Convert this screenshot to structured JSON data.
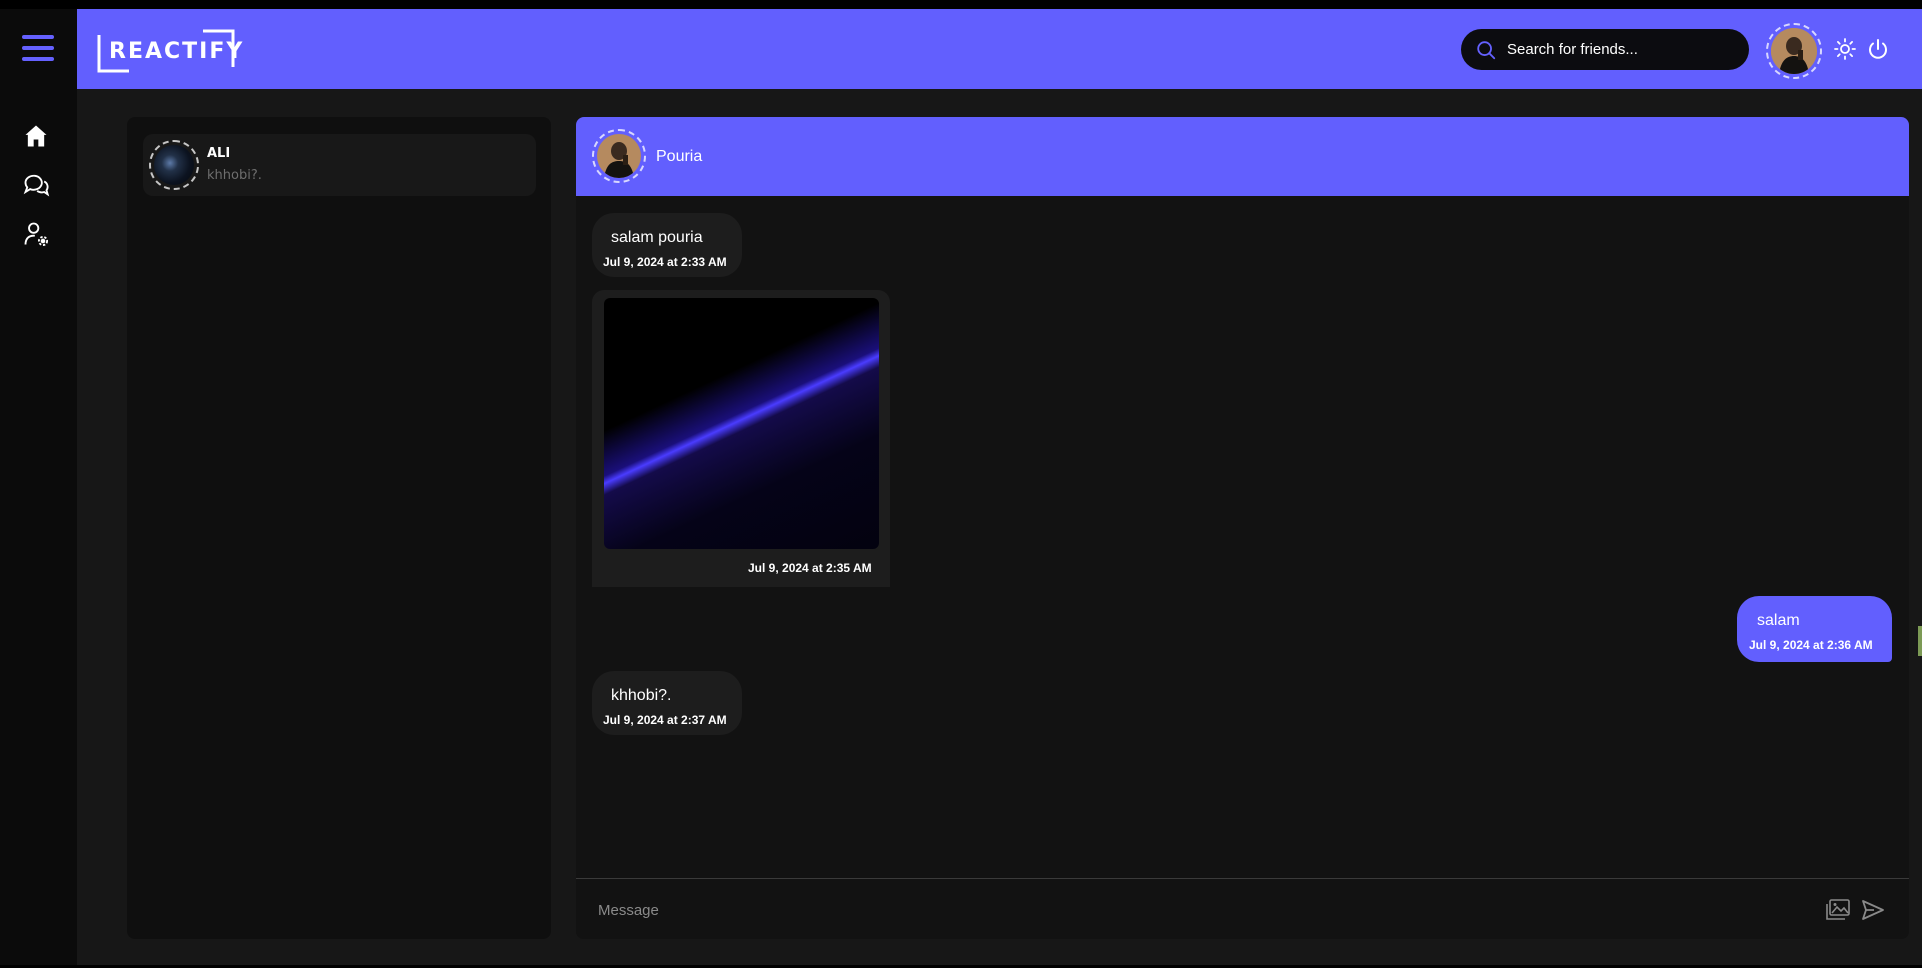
{
  "app": {
    "logo_text": "REACTIFY",
    "accent": "#625ffe"
  },
  "sidebar": {
    "items": [
      {
        "name": "home",
        "icon": "home-icon"
      },
      {
        "name": "chats",
        "icon": "chat-bubbles-icon"
      },
      {
        "name": "profile-settings",
        "icon": "user-gear-icon"
      }
    ]
  },
  "header": {
    "search": {
      "placeholder": "Search for friends..."
    },
    "theme_icon": "sun-icon",
    "logout_icon": "power-icon"
  },
  "chat_list": {
    "items": [
      {
        "name": "ALI",
        "last_message": "khhobi?."
      }
    ]
  },
  "conversation": {
    "contact_name": "Pouria",
    "messages": [
      {
        "direction": "in",
        "text": "salam pouria",
        "time": "Jul 9, 2024 at 2:33 AM"
      },
      {
        "direction": "in",
        "type": "image",
        "time": "Jul 9, 2024 at 2:35 AM"
      },
      {
        "direction": "out",
        "text": "salam",
        "time": "Jul 9, 2024 at 2:36 AM"
      },
      {
        "direction": "in",
        "text": "khhobi?.",
        "time": "Jul 9, 2024 at 2:37 AM"
      }
    ],
    "composer": {
      "placeholder": "Message"
    }
  }
}
